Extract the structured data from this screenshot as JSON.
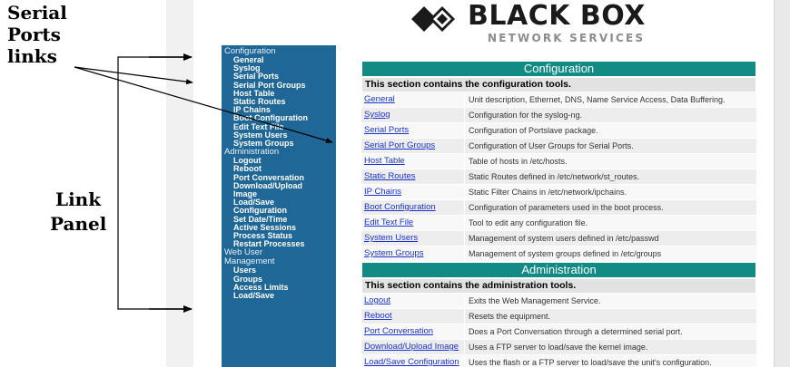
{
  "callouts": {
    "serial_line1": "Serial",
    "serial_line2": "Ports",
    "serial_line3": "links",
    "link_line1": "Link",
    "link_line2": "Panel"
  },
  "logo": {
    "title": "BLACK BOX",
    "subtitle": "NETWORK SERVICES"
  },
  "colors": {
    "sidebar": "#1f6797",
    "section_header": "#128b84",
    "link": "#1a33cc"
  },
  "sidebar": {
    "items": [
      {
        "type": "head",
        "label": "Configuration"
      },
      {
        "type": "item",
        "label": "General"
      },
      {
        "type": "item",
        "label": "Syslog"
      },
      {
        "type": "item",
        "label": "Serial Ports"
      },
      {
        "type": "item",
        "label": "Serial Port Groups"
      },
      {
        "type": "item",
        "label": "Host Table"
      },
      {
        "type": "item",
        "label": "Static Routes"
      },
      {
        "type": "item",
        "label": "IP Chains"
      },
      {
        "type": "item",
        "label": "Boot Configuration"
      },
      {
        "type": "item",
        "label": "Edit Text File"
      },
      {
        "type": "item",
        "label": "System Users"
      },
      {
        "type": "item",
        "label": "System Groups"
      },
      {
        "type": "head",
        "label": "Administration"
      },
      {
        "type": "item",
        "label": "Logout"
      },
      {
        "type": "item",
        "label": "Reboot"
      },
      {
        "type": "item",
        "label": "Port Conversation"
      },
      {
        "type": "item",
        "label": "Download/Upload"
      },
      {
        "type": "item",
        "label": "Image"
      },
      {
        "type": "item",
        "label": "Load/Save"
      },
      {
        "type": "item",
        "label": "Configuration"
      },
      {
        "type": "item",
        "label": "Set Date/Time"
      },
      {
        "type": "item",
        "label": "Active Sessions"
      },
      {
        "type": "item",
        "label": "Process Status"
      },
      {
        "type": "item",
        "label": "Restart Processes"
      },
      {
        "type": "head",
        "label": "Web User"
      },
      {
        "type": "head",
        "label": "Management"
      },
      {
        "type": "item",
        "label": "Users"
      },
      {
        "type": "item",
        "label": "Groups"
      },
      {
        "type": "item",
        "label": "Access Limits"
      },
      {
        "type": "item",
        "label": "Load/Save"
      }
    ]
  },
  "configuration": {
    "title": "Configuration",
    "intro": "This section contains the configuration tools.",
    "rows": [
      {
        "link": "General",
        "desc": "Unit description, Ethernet, DNS, Name Service Access, Data Buffering."
      },
      {
        "link": "Syslog",
        "desc": "Configuration for the syslog-ng."
      },
      {
        "link": "Serial Ports",
        "desc": "Configuration of Portslave package."
      },
      {
        "link": "Serial Port Groups",
        "desc": "Configuration of User Groups for Serial Ports."
      },
      {
        "link": "Host Table",
        "desc": "Table of hosts in /etc/hosts."
      },
      {
        "link": "Static Routes",
        "desc": "Static Routes defined in /etc/network/st_routes."
      },
      {
        "link": "IP Chains",
        "desc": "Static Filter Chains in /etc/network/ipchains."
      },
      {
        "link": "Boot Configuration",
        "desc": "Configuration of parameters used in the boot process."
      },
      {
        "link": "Edit Text File",
        "desc": "Tool to edit any configuration file."
      },
      {
        "link": "System Users",
        "desc": "Management of system users defined in /etc/passwd"
      },
      {
        "link": "System Groups",
        "desc": "Management of system groups defined in /etc/groups"
      }
    ]
  },
  "administration": {
    "title": "Administration",
    "intro": "This section contains the administration tools.",
    "rows": [
      {
        "link": "Logout",
        "desc": "Exits the Web Management Service."
      },
      {
        "link": "Reboot",
        "desc": "Resets the equipment."
      },
      {
        "link": "Port Conversation",
        "desc": "Does a Port Conversation through a determined serial port."
      },
      {
        "link": "Download/Upload Image",
        "desc": "Uses a FTP server to load/save the kernel image."
      },
      {
        "link": "Load/Save Configuration",
        "desc": "Uses the flash or a FTP server to load/save the unit's configuration."
      }
    ]
  }
}
